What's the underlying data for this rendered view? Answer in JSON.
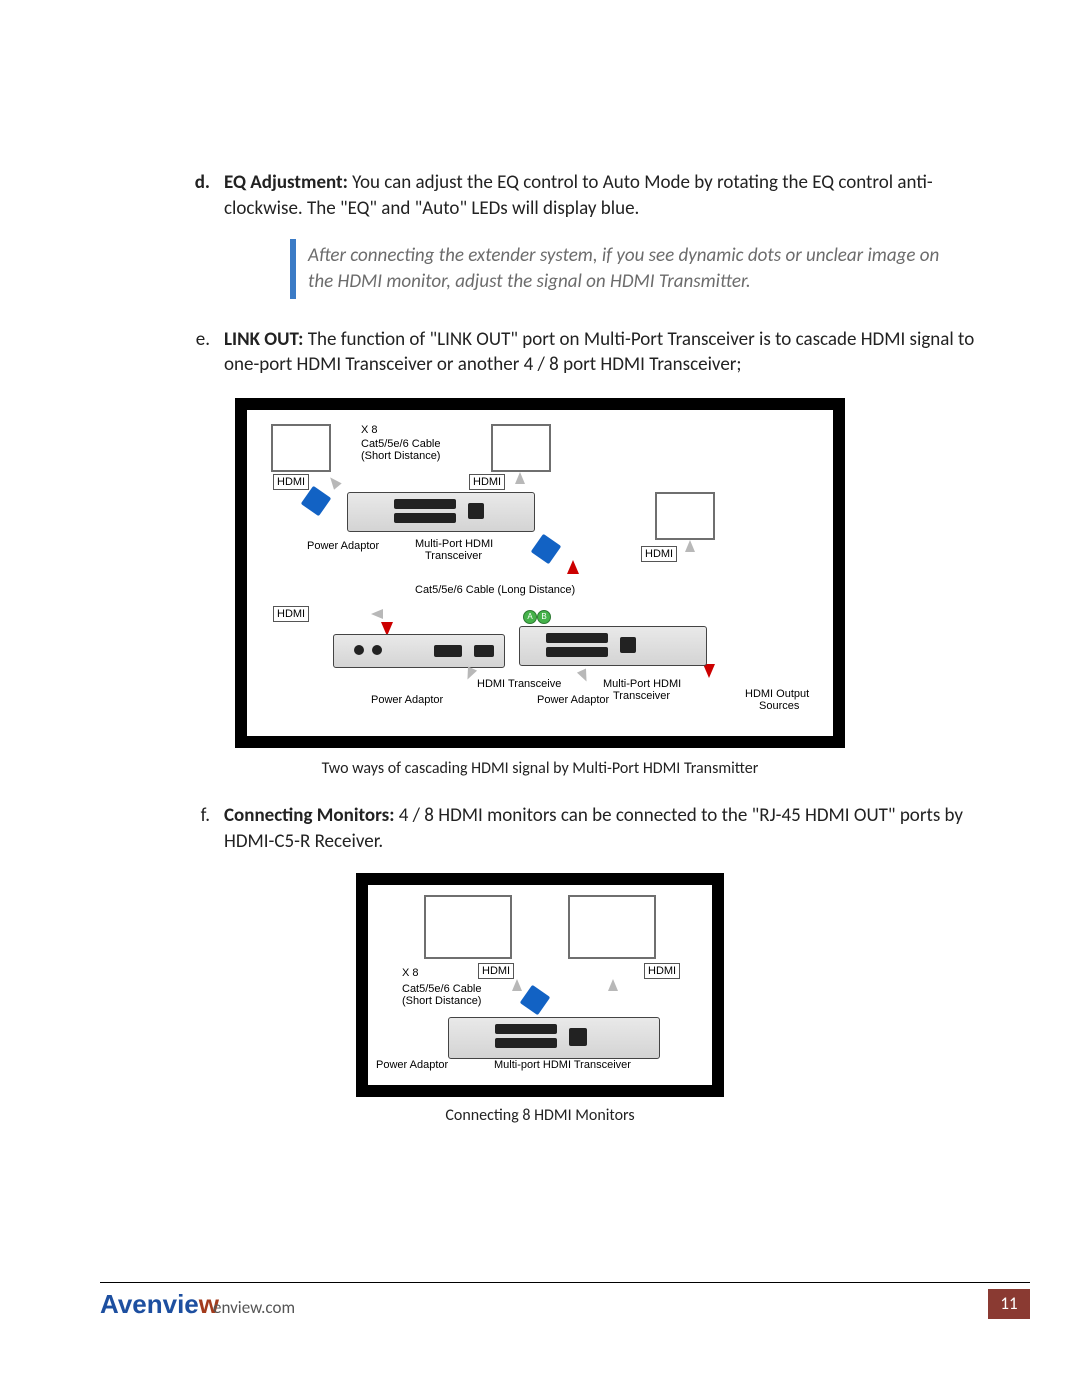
{
  "list": {
    "d": {
      "marker": "d.",
      "title": "EQ Adjustment:",
      "text": " You can adjust the EQ control to Auto Mode by rotating the EQ control anti-clockwise. The \"EQ\" and \"Auto\" LEDs will display blue."
    },
    "tip": "After connecting the extender system, if you see dynamic dots or unclear image on the HDMI monitor, adjust the signal on HDMI Transmitter.",
    "e": {
      "marker": "e.",
      "title": "LINK    OUT:",
      "text": " The function of \"LINK OUT\" port on Multi-Port Transceiver is to cascade HDMI signal to one-port HDMI Transceiver or another 4 / 8 port HDMI Transceiver;"
    },
    "f": {
      "marker": "f.",
      "title": "Connecting Monitors:",
      "text": " 4 / 8 HDMI monitors can be connected to the \"RJ-45 HDMI OUT\" ports by HDMI-C5-R Receiver."
    }
  },
  "fig1": {
    "labels": {
      "x8": "X 8",
      "cable_short1": "Cat5/5e/6 Cable",
      "cable_short2": "(Short Distance)",
      "hdmi": "HDMI",
      "power_adaptor": "Power Adaptor",
      "multi_port1": "Multi-Port HDMI",
      "multi_port2": "Transceiver",
      "cable_long": "Cat5/5e/6 Cable (Long Distance)",
      "hdmi_trans": "HDMI Transceive",
      "hdmi_out1": "HDMI Output",
      "hdmi_out2": "Sources",
      "a": "A",
      "b": "B"
    },
    "caption": "Two ways of cascading HDMI signal by Multi-Port HDMI Transmitter"
  },
  "fig2": {
    "labels": {
      "x8": "X 8",
      "cable_short1": "Cat5/5e/6 Cable",
      "cable_short2": "(Short Distance)",
      "hdmi": "HDMI",
      "power_adaptor": "Power Adaptor",
      "multi_port": "Multi-port HDMI Transceiver"
    },
    "caption": "Connecting 8 HDMI Monitors"
  },
  "footer": {
    "brand_a": "A",
    "brand_v": "v",
    "brand_rest": "envie",
    "brand_w": "w",
    "domain_tail": "enview.com",
    "page": "11"
  }
}
